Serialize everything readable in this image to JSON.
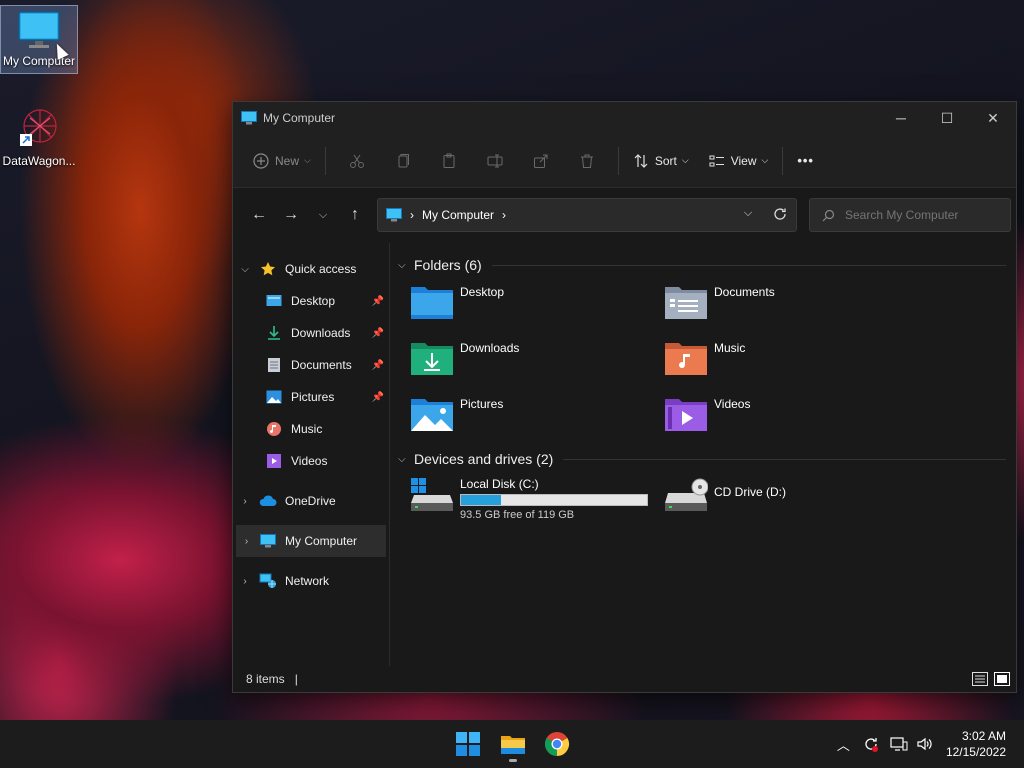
{
  "desktop": {
    "icons": [
      {
        "label": "My Computer",
        "icon": "monitor-icon",
        "selected": true
      },
      {
        "label": "DataWagon...",
        "icon": "datawagon-shortcut-icon",
        "selected": false
      }
    ]
  },
  "window": {
    "title": "My Computer",
    "controls": {
      "minimize": "─",
      "maximize": "☐",
      "close": "✕"
    }
  },
  "toolbar": {
    "new_label": "New",
    "sort_label": "Sort",
    "view_label": "View",
    "more_label": "•••"
  },
  "address": {
    "location": "My Computer",
    "separator": "›",
    "search_placeholder": "Search My Computer"
  },
  "nav": {
    "quick_access": "Quick access",
    "pinned": [
      {
        "label": "Desktop",
        "icon": "desktop-icon",
        "pinned": true
      },
      {
        "label": "Downloads",
        "icon": "download-icon",
        "pinned": true
      },
      {
        "label": "Documents",
        "icon": "documents-icon",
        "pinned": true
      },
      {
        "label": "Pictures",
        "icon": "pictures-icon",
        "pinned": true
      },
      {
        "label": "Music",
        "icon": "music-icon",
        "pinned": false
      },
      {
        "label": "Videos",
        "icon": "videos-icon",
        "pinned": false
      }
    ],
    "onedrive": "OneDrive",
    "my_computer": "My Computer",
    "network": "Network"
  },
  "content": {
    "folders_header": "Folders (6)",
    "folders": [
      {
        "label": "Desktop",
        "icon": "desktop-folder-icon"
      },
      {
        "label": "Documents",
        "icon": "documents-folder-icon"
      },
      {
        "label": "Downloads",
        "icon": "downloads-folder-icon"
      },
      {
        "label": "Music",
        "icon": "music-folder-icon"
      },
      {
        "label": "Pictures",
        "icon": "pictures-folder-icon"
      },
      {
        "label": "Videos",
        "icon": "videos-folder-icon"
      }
    ],
    "drives_header": "Devices and drives (2)",
    "drives": [
      {
        "label": "Local Disk (C:)",
        "free_text": "93.5 GB free of 119 GB",
        "used_fraction": 0.214
      },
      {
        "label": "CD Drive (D:)"
      }
    ]
  },
  "status": {
    "items": "8 items"
  },
  "taskbar": {
    "apps": [
      "start-icon",
      "file-explorer-icon",
      "chrome-icon"
    ],
    "time": "3:02 AM",
    "date": "12/15/2022"
  },
  "colors": {
    "accent": "#26a0da",
    "window_bg": "#191919",
    "folder_blue": "#2f8fe0",
    "folder_green": "#1fa87a"
  }
}
